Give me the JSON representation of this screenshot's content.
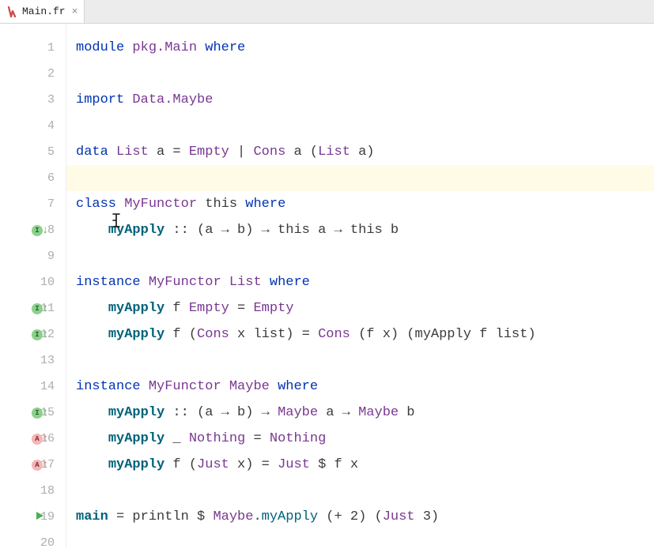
{
  "tab": {
    "filename": "Main.fr",
    "close_glyph": "×"
  },
  "gutter": {
    "lines": 20,
    "badges": {
      "8": {
        "kind": "i",
        "arrow": "down"
      },
      "11": {
        "kind": "i",
        "arrow": "up-green"
      },
      "12": {
        "kind": "i",
        "arrow": "up-green"
      },
      "15": {
        "kind": "i",
        "arrow": "up-green"
      },
      "16": {
        "kind": "a",
        "arrow": "up-red"
      },
      "17": {
        "kind": "a",
        "arrow": "up-red"
      },
      "19": {
        "kind": "run"
      }
    }
  },
  "code": {
    "l1": {
      "a": "module ",
      "b": "pkg.Main",
      "c": " where"
    },
    "l3": {
      "a": "import ",
      "b": "Data.Maybe"
    },
    "l5": {
      "a": "data ",
      "b": "List",
      "c": " a = ",
      "d": "Empty",
      "e": " | ",
      "f": "Cons",
      "g": " a (",
      "h": "List",
      "i": " a)"
    },
    "l7": {
      "a": "class ",
      "b": "MyFunctor",
      "c": " this ",
      "d": "where"
    },
    "l8": {
      "a": "    ",
      "b": "myApply",
      "c": " :: (a → b) → this a → this b"
    },
    "l10": {
      "a": "instance ",
      "b": "MyFunctor",
      "c": " ",
      "d": "List",
      "e": " ",
      "f": "where"
    },
    "l11": {
      "a": "    ",
      "b": "myApply",
      "c": " f ",
      "d": "Empty",
      "e": " = ",
      "f": "Empty"
    },
    "l12": {
      "a": "    ",
      "b": "myApply",
      "c": " f (",
      "d": "Cons",
      "e": " x list) = ",
      "f": "Cons",
      "g": " (f x) (myApply f list)"
    },
    "l14": {
      "a": "instance ",
      "b": "MyFunctor",
      "c": " ",
      "d": "Maybe",
      "e": " ",
      "f": "where"
    },
    "l15": {
      "a": "    ",
      "b": "myApply",
      "c": " :: (a → b) → ",
      "d": "Maybe",
      "e": " a → ",
      "f": "Maybe",
      "g": " b"
    },
    "l16": {
      "a": "    ",
      "b": "myApply",
      "c": " _ ",
      "d": "Nothing",
      "e": " = ",
      "f": "Nothing"
    },
    "l17": {
      "a": "    ",
      "b": "myApply",
      "c": " f (",
      "d": "Just",
      "e": " x) = ",
      "f": "Just",
      "g": " $ f x"
    },
    "l19": {
      "a": "main",
      "b": " = println $ ",
      "c": "Maybe",
      "d": ".",
      "e": "myApply",
      "f": " (+ 2) (",
      "g": "Just",
      "h": " 3)"
    }
  },
  "cursor": {
    "line": 8,
    "col_hint": "inside myApply"
  }
}
